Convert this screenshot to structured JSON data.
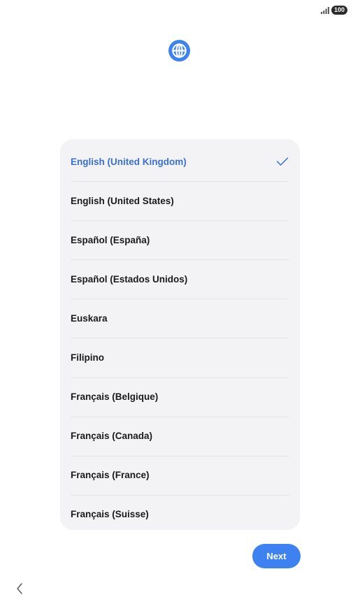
{
  "status_bar": {
    "signal_icon": "signal-bars-icon",
    "battery_level": "100"
  },
  "header": {
    "icon": "globe-icon",
    "accent_color": "#3e82f1"
  },
  "languages": {
    "selected_index": 0,
    "selected_color": "#3870d6",
    "items": [
      {
        "label": "English (United Kingdom)",
        "selected": true
      },
      {
        "label": "English (United States)",
        "selected": false
      },
      {
        "label": "Español (España)",
        "selected": false
      },
      {
        "label": "Español (Estados Unidos)",
        "selected": false
      },
      {
        "label": "Euskara",
        "selected": false
      },
      {
        "label": "Filipino",
        "selected": false
      },
      {
        "label": "Français (Belgique)",
        "selected": false
      },
      {
        "label": "Français (Canada)",
        "selected": false
      },
      {
        "label": "Français (France)",
        "selected": false
      },
      {
        "label": "Français (Suisse)",
        "selected": false
      }
    ]
  },
  "footer": {
    "next_label": "Next",
    "back_icon": "chevron-left-icon"
  }
}
